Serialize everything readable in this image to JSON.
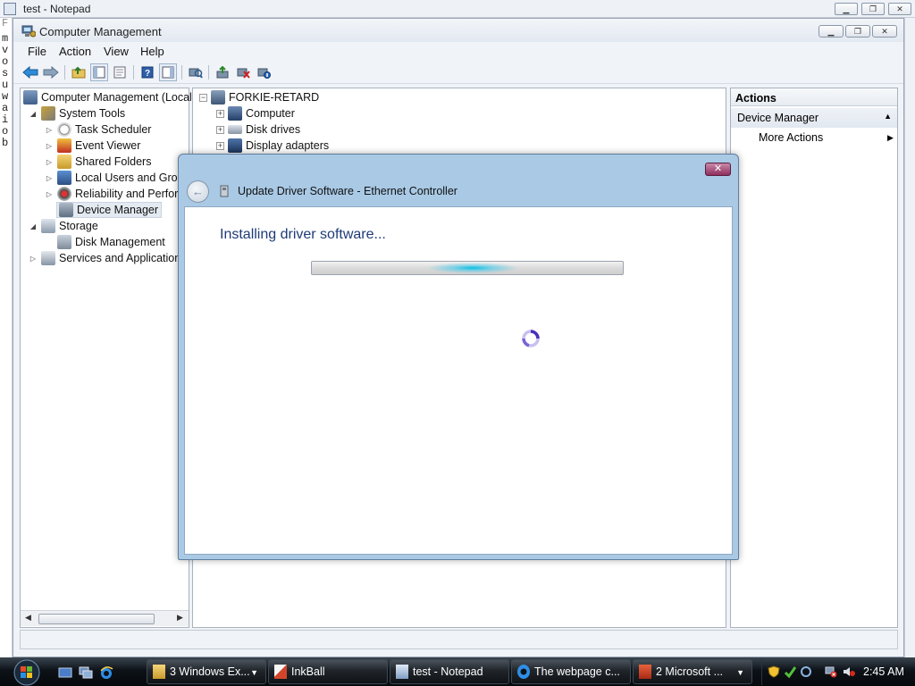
{
  "notepad": {
    "title": "test - Notepad",
    "left_chars": [
      "F",
      "m",
      "v",
      "o",
      "s",
      "u",
      "w",
      "a",
      "i",
      "o",
      "b"
    ]
  },
  "cm": {
    "title": "Computer Management",
    "menu": [
      "File",
      "Action",
      "View",
      "Help"
    ],
    "tree": {
      "root": "Computer Management (Local",
      "system_tools": "System Tools",
      "task_scheduler": "Task Scheduler",
      "event_viewer": "Event Viewer",
      "shared_folders": "Shared Folders",
      "local_users": "Local Users and Group",
      "reliability": "Reliability and Perform",
      "device_manager": "Device Manager",
      "storage": "Storage",
      "disk_management": "Disk Management",
      "services": "Services and Applications"
    },
    "devices": {
      "host": "FORKIE-RETARD",
      "computer": "Computer",
      "disk_drives": "Disk drives",
      "display_adapters": "Display adapters"
    },
    "actions": {
      "header": "Actions",
      "group": "Device Manager",
      "more": "More Actions"
    }
  },
  "dialog": {
    "title": "Update Driver Software - Ethernet Controller",
    "heading": "Installing driver software...",
    "progress_style": "indeterminate-marquee"
  },
  "taskbar": {
    "items": [
      {
        "label": "3 Windows Ex...",
        "icon": "folder-icon"
      },
      {
        "label": "InkBall",
        "icon": "inkball-icon"
      },
      {
        "label": "test - Notepad",
        "icon": "notepad-icon"
      },
      {
        "label": "The webpage c...",
        "icon": "ie-icon"
      },
      {
        "label": "2 Microsoft ...",
        "icon": "office-icon"
      }
    ],
    "clock": "2:45 AM"
  }
}
